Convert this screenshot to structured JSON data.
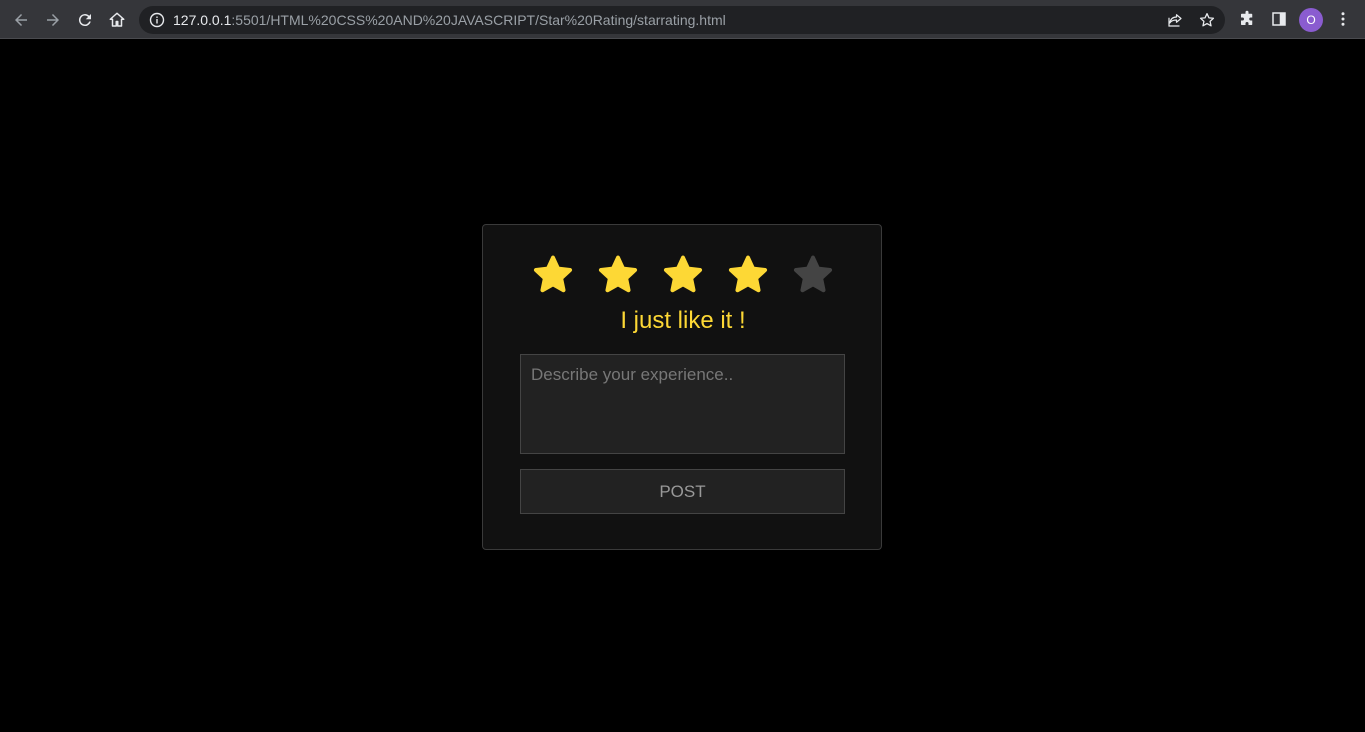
{
  "browser": {
    "url_host": "127.0.0.1",
    "url_rest": ":5501/HTML%20CSS%20AND%20JAVASCRIPT/Star%20Rating/starrating.html",
    "profile_initial": "O"
  },
  "rating": {
    "value": 4,
    "max": 5,
    "filled_color": "#fdd835",
    "empty_color": "#444444",
    "label": "I just like it !"
  },
  "feedback": {
    "placeholder": "Describe your experience..",
    "value": ""
  },
  "post_button": {
    "label": "POST"
  },
  "colors": {
    "page_bg": "#000000",
    "card_bg": "#111111",
    "card_border": "#3a3a3a",
    "text_accent": "#fdd835"
  },
  "icons": [
    "back-arrow-icon",
    "forward-arrow-icon",
    "reload-icon",
    "home-icon",
    "info-icon",
    "share-icon",
    "bookmark-star-icon",
    "extensions-puzzle-icon",
    "side-panel-icon",
    "menu-kebab-icon",
    "star-icon"
  ]
}
